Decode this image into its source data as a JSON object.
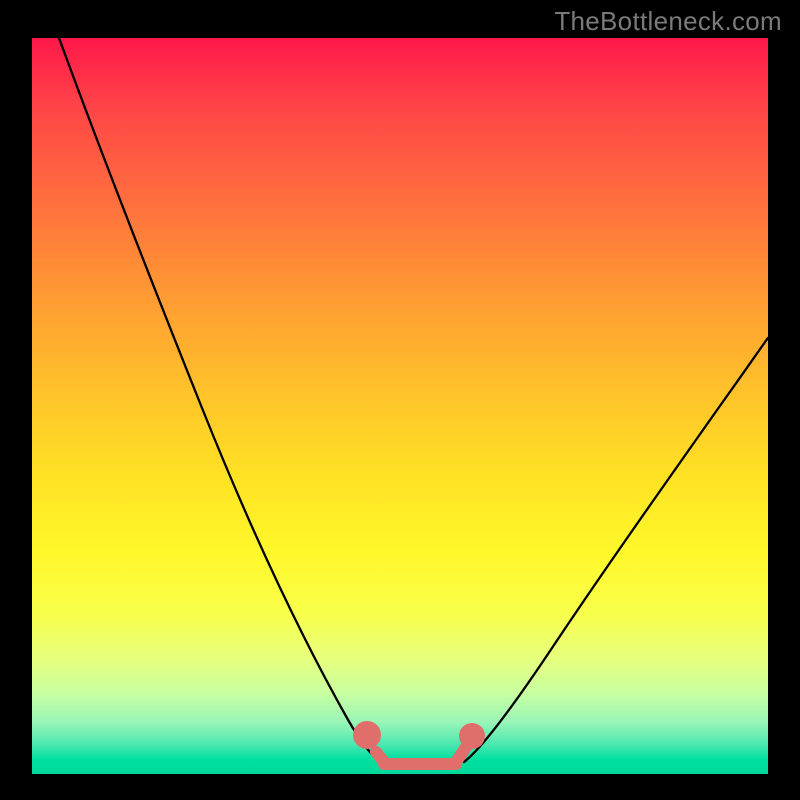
{
  "watermark": "TheBottleneck.com",
  "chart_data": {
    "type": "line",
    "title": "",
    "xlabel": "",
    "ylabel": "",
    "xlim": [
      0,
      100
    ],
    "ylim": [
      0,
      100
    ],
    "grid": false,
    "legend": false,
    "series": [
      {
        "name": "left-curve",
        "color": "#000000",
        "x": [
          4,
          10,
          16,
          22,
          28,
          34,
          40,
          44,
          48
        ],
        "y": [
          100,
          88,
          75,
          62,
          48,
          34,
          19,
          9,
          3
        ]
      },
      {
        "name": "right-curve",
        "color": "#000000",
        "x": [
          58,
          62,
          68,
          74,
          80,
          86,
          92,
          98,
          100
        ],
        "y": [
          3,
          8,
          16,
          24,
          32,
          40,
          48,
          56,
          59
        ]
      },
      {
        "name": "bottom-marker",
        "color": "#e06f6c",
        "x": [
          45,
          46,
          48,
          50,
          52,
          54,
          56,
          57,
          58,
          59
        ],
        "y": [
          5,
          3,
          1.5,
          1.2,
          1.2,
          1.2,
          1.3,
          2,
          4,
          6
        ]
      }
    ],
    "annotations": []
  }
}
